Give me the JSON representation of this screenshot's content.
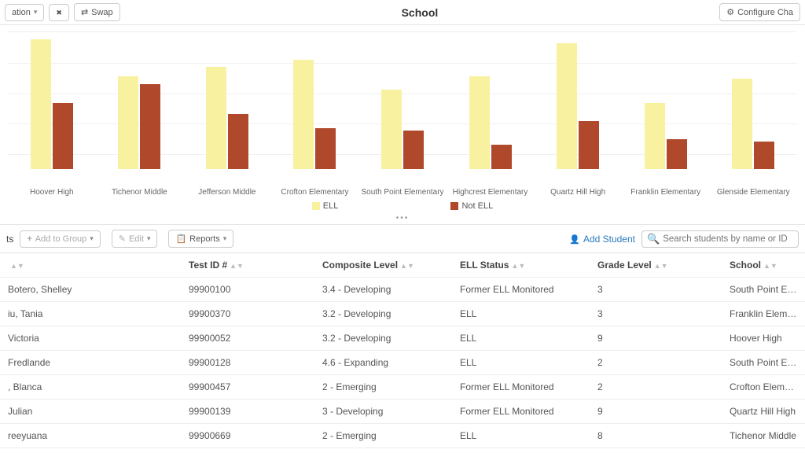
{
  "toolbar": {
    "left_btn_label": "ation",
    "swap_label": "Swap",
    "title": "School",
    "configure_label": "Configure Cha"
  },
  "legend": {
    "ell": "ELL",
    "not_ell": "Not ELL"
  },
  "chart_data": {
    "type": "bar",
    "title": "School",
    "xlabel": "",
    "ylabel": "",
    "ylim": [
      0,
      100
    ],
    "categories": [
      "Hoover High",
      "Tichenor Middle",
      "Jefferson Middle",
      "Crofton Elementary",
      "South Point Elementary",
      "Highcrest Elementary",
      "Quartz Hill High",
      "Franklin Elementary",
      "Glenside Elementary"
    ],
    "series": [
      {
        "name": "ELL",
        "values": [
          95,
          68,
          75,
          80,
          58,
          68,
          92,
          48,
          66
        ]
      },
      {
        "name": "Not ELL",
        "values": [
          48,
          62,
          40,
          30,
          28,
          18,
          35,
          22,
          20
        ]
      }
    ]
  },
  "midbar": {
    "partial_left": "ts",
    "add_to_group": "Add to Group",
    "edit": "Edit",
    "reports": "Reports",
    "add_student": "Add Student",
    "search_placeholder": "Search students by name or ID"
  },
  "table": {
    "headers": {
      "name": "",
      "test_id": "Test ID #",
      "composite": "Composite Level",
      "ell_status": "ELL Status",
      "grade": "Grade Level",
      "school": "School"
    },
    "rows": [
      {
        "name": "Botero, Shelley",
        "id": "99900100",
        "comp": "3.4 - Developing",
        "ell": "Former ELL Monitored",
        "grade": "3",
        "school": "South Point Elementa"
      },
      {
        "name": "iu, Tania",
        "id": "99900370",
        "comp": "3.2 - Developing",
        "ell": "ELL",
        "grade": "3",
        "school": "Franklin Elementary"
      },
      {
        "name": "Victoria",
        "id": "99900052",
        "comp": "3.2 - Developing",
        "ell": "ELL",
        "grade": "9",
        "school": "Hoover High"
      },
      {
        "name": "Fredlande",
        "id": "99900128",
        "comp": "4.6 - Expanding",
        "ell": "ELL",
        "grade": "2",
        "school": "South Point Elementa"
      },
      {
        "name": ", Blanca",
        "id": "99900457",
        "comp": "2 - Emerging",
        "ell": "Former ELL Monitored",
        "grade": "2",
        "school": "Crofton Elementary"
      },
      {
        "name": "Julian",
        "id": "99900139",
        "comp": "3 - Developing",
        "ell": "Former ELL Monitored",
        "grade": "9",
        "school": "Quartz Hill High"
      },
      {
        "name": "reeyuana",
        "id": "99900669",
        "comp": "2 - Emerging",
        "ell": "ELL",
        "grade": "8",
        "school": "Tichenor Middle"
      }
    ]
  }
}
